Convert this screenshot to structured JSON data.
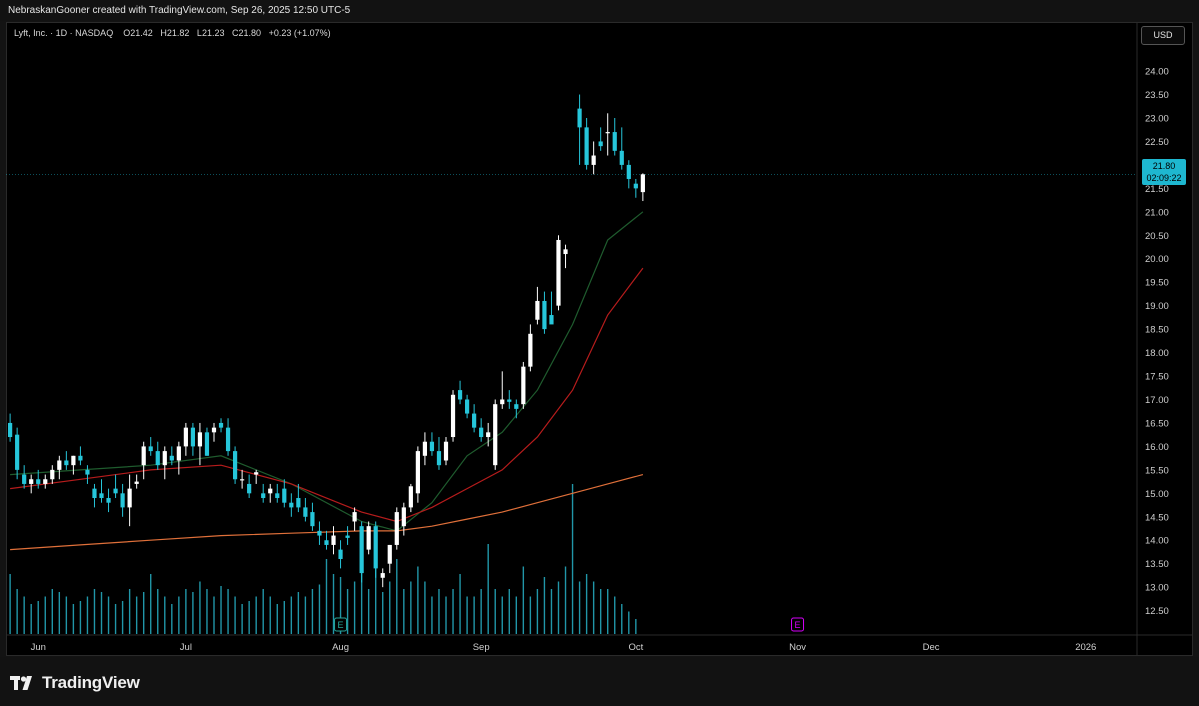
{
  "header": {
    "attribution": "NebraskanGooner created with TradingView.com, Sep 26, 2025 12:50 UTC-5"
  },
  "legend": {
    "symbol_info": "Lyft, Inc. · 1D · NASDAQ",
    "o_label": "O",
    "o_value": "21.42",
    "h_label": "H",
    "h_value": "21.82",
    "l_label": "L",
    "l_value": "21.23",
    "c_label": "C",
    "c_value": "21.80",
    "change": "+0.23 (+1.07%)"
  },
  "currency_button": "USD",
  "last_price": {
    "value": "21.80",
    "countdown": "02:09:22"
  },
  "footer": {
    "brand": "TradingView"
  },
  "colors": {
    "up_candle": "#ffffff",
    "down_candle": "#26c6da",
    "ema_fast": "#1f5c2e",
    "ema_mid": "#b71c1c",
    "ema_slow": "#e0703a",
    "volume": "#2196a8",
    "last_price_tag": "#1eb7d0",
    "earnings_marker_past": "#26a69a",
    "earnings_marker_future": "#d500f9"
  },
  "chart_data": {
    "type": "candlestick",
    "y_axis": {
      "range": [
        12.3,
        24.3
      ],
      "ticks": [
        "24.00",
        "23.50",
        "23.00",
        "22.50",
        "22.00",
        "21.50",
        "21.00",
        "20.50",
        "20.00",
        "19.50",
        "19.00",
        "18.50",
        "18.00",
        "17.50",
        "17.00",
        "16.50",
        "16.00",
        "15.50",
        "15.00",
        "14.50",
        "14.00",
        "13.50",
        "13.00",
        "12.50"
      ]
    },
    "x_axis": {
      "ticks": [
        {
          "label": "Jun",
          "index": 4
        },
        {
          "label": "Jul",
          "index": 25
        },
        {
          "label": "Aug",
          "index": 47
        },
        {
          "label": "Sep",
          "index": 67
        },
        {
          "label": "Oct",
          "index": 89
        },
        {
          "label": "Nov",
          "index": 112
        },
        {
          "label": "Dec",
          "index": 131
        },
        {
          "label": "2026",
          "index": 153
        }
      ],
      "index_range": [
        -0.3,
        160
      ]
    },
    "candles": [
      [
        16.5,
        16.7,
        16.1,
        16.2
      ],
      [
        16.25,
        16.4,
        15.3,
        15.5
      ],
      [
        15.4,
        15.6,
        15.1,
        15.2
      ],
      [
        15.2,
        15.4,
        15.0,
        15.3
      ],
      [
        15.3,
        15.5,
        15.1,
        15.2
      ],
      [
        15.2,
        15.4,
        15.1,
        15.3
      ],
      [
        15.3,
        15.6,
        15.2,
        15.5
      ],
      [
        15.5,
        15.8,
        15.3,
        15.7
      ],
      [
        15.7,
        15.9,
        15.5,
        15.6
      ],
      [
        15.6,
        15.8,
        15.4,
        15.8
      ],
      [
        15.8,
        16.0,
        15.6,
        15.7
      ],
      [
        15.5,
        15.6,
        15.2,
        15.4
      ],
      [
        15.1,
        15.2,
        14.7,
        14.9
      ],
      [
        15.0,
        15.3,
        14.8,
        14.9
      ],
      [
        14.9,
        15.1,
        14.6,
        14.8
      ],
      [
        15.1,
        15.4,
        14.9,
        15.0
      ],
      [
        15.0,
        15.2,
        14.5,
        14.7
      ],
      [
        14.7,
        15.4,
        14.3,
        15.1
      ],
      [
        15.2,
        15.4,
        15.1,
        15.25
      ],
      [
        15.6,
        16.1,
        15.3,
        16.0
      ],
      [
        16.0,
        16.2,
        15.8,
        15.9
      ],
      [
        15.9,
        16.1,
        15.5,
        15.6
      ],
      [
        15.6,
        16.0,
        15.3,
        15.9
      ],
      [
        15.8,
        16.0,
        15.6,
        15.7
      ],
      [
        15.7,
        16.1,
        15.4,
        16.0
      ],
      [
        16.0,
        16.5,
        15.8,
        16.4
      ],
      [
        16.4,
        16.5,
        15.8,
        16.0
      ],
      [
        16.0,
        16.5,
        15.6,
        16.3
      ],
      [
        16.3,
        16.4,
        15.8,
        15.8
      ],
      [
        16.3,
        16.5,
        16.1,
        16.4
      ],
      [
        16.5,
        16.6,
        16.3,
        16.4
      ],
      [
        16.4,
        16.6,
        15.8,
        15.9
      ],
      [
        15.9,
        16.0,
        15.2,
        15.3
      ],
      [
        15.3,
        15.5,
        15.1,
        15.3
      ],
      [
        15.2,
        15.4,
        14.9,
        15.0
      ],
      [
        15.4,
        15.5,
        15.2,
        15.45
      ],
      [
        15.0,
        15.2,
        14.8,
        14.9
      ],
      [
        15.0,
        15.2,
        14.8,
        15.1
      ],
      [
        15.0,
        15.2,
        14.8,
        14.9
      ],
      [
        15.1,
        15.3,
        14.7,
        14.8
      ],
      [
        14.8,
        15.0,
        14.5,
        14.7
      ],
      [
        14.9,
        15.2,
        14.6,
        14.7
      ],
      [
        14.7,
        14.9,
        14.4,
        14.5
      ],
      [
        14.6,
        14.8,
        14.2,
        14.3
      ],
      [
        14.2,
        14.4,
        13.9,
        14.1
      ],
      [
        14.0,
        14.2,
        13.8,
        13.9
      ],
      [
        13.9,
        14.3,
        13.7,
        14.1
      ],
      [
        13.8,
        14.0,
        13.4,
        13.6
      ],
      [
        14.1,
        14.3,
        13.9,
        14.05
      ],
      [
        14.4,
        14.7,
        14.2,
        14.6
      ],
      [
        14.3,
        14.4,
        13.1,
        13.3
      ],
      [
        13.8,
        14.4,
        13.7,
        14.3
      ],
      [
        14.3,
        14.4,
        13.2,
        13.4
      ],
      [
        13.2,
        13.4,
        13.0,
        13.3
      ],
      [
        13.5,
        13.9,
        13.3,
        13.9
      ],
      [
        13.9,
        14.7,
        13.8,
        14.6
      ],
      [
        14.3,
        14.8,
        14.1,
        14.7
      ],
      [
        14.7,
        15.2,
        14.6,
        15.15
      ],
      [
        15.0,
        16.0,
        14.8,
        15.9
      ],
      [
        15.8,
        16.3,
        15.6,
        16.1
      ],
      [
        16.1,
        16.3,
        15.8,
        15.9
      ],
      [
        15.9,
        16.2,
        15.5,
        15.6
      ],
      [
        15.7,
        16.2,
        15.6,
        16.1
      ],
      [
        16.2,
        17.2,
        16.1,
        17.1
      ],
      [
        17.2,
        17.4,
        16.9,
        17.0
      ],
      [
        17.0,
        17.1,
        16.6,
        16.7
      ],
      [
        16.7,
        16.9,
        16.3,
        16.4
      ],
      [
        16.4,
        16.6,
        16.1,
        16.2
      ],
      [
        16.2,
        16.5,
        16.0,
        16.3
      ],
      [
        15.6,
        17.0,
        15.5,
        16.9
      ],
      [
        16.9,
        17.6,
        16.8,
        17.0
      ],
      [
        17.0,
        17.2,
        16.8,
        16.95
      ],
      [
        16.9,
        17.0,
        16.6,
        16.8
      ],
      [
        16.9,
        17.8,
        16.8,
        17.7
      ],
      [
        17.7,
        18.6,
        17.6,
        18.4
      ],
      [
        18.7,
        19.4,
        18.6,
        19.1
      ],
      [
        19.1,
        19.3,
        18.4,
        18.5
      ],
      [
        18.8,
        19.3,
        18.7,
        18.6
      ],
      [
        19.0,
        20.5,
        18.9,
        20.4
      ],
      [
        20.1,
        20.3,
        19.8,
        20.2
      ],
      [
        23.2,
        23.5,
        22.0,
        22.8
      ],
      [
        22.8,
        23.0,
        21.9,
        22.0
      ],
      [
        22.0,
        22.5,
        21.8,
        22.2
      ],
      [
        22.5,
        22.8,
        22.3,
        22.4
      ],
      [
        22.7,
        23.1,
        22.2,
        22.7
      ],
      [
        22.7,
        23.0,
        22.2,
        22.3
      ],
      [
        22.3,
        22.8,
        21.9,
        22.0
      ],
      [
        22.0,
        22.1,
        21.5,
        21.7
      ],
      [
        21.6,
        21.7,
        21.3,
        21.5
      ],
      [
        21.42,
        21.82,
        21.23,
        21.8
      ]
    ],
    "candle_indices": [
      0,
      1,
      2,
      3,
      4,
      5,
      6,
      7,
      8,
      9,
      10,
      11,
      12,
      13,
      14,
      15,
      16,
      17,
      18,
      19,
      20,
      21,
      22,
      23,
      24,
      25,
      26,
      27,
      28,
      29,
      30,
      31,
      32,
      33,
      34,
      35,
      36,
      37,
      38,
      39,
      40,
      41,
      42,
      43,
      44,
      45,
      46,
      47,
      48,
      49,
      50,
      51,
      52,
      53,
      54,
      55,
      56,
      57,
      58,
      59,
      60,
      61,
      62,
      63,
      64,
      65,
      66,
      67,
      68,
      69,
      70,
      71,
      72,
      73,
      74,
      75,
      76,
      77,
      78,
      79,
      81,
      82,
      83,
      84,
      85,
      86,
      87,
      88,
      89,
      90
    ],
    "moving_averages": [
      {
        "color_key": "ema_fast",
        "values": [
          [
            0,
            15.4
          ],
          [
            10,
            15.5
          ],
          [
            20,
            15.6
          ],
          [
            30,
            15.8
          ],
          [
            40,
            15.2
          ],
          [
            50,
            14.4
          ],
          [
            55,
            14.2
          ],
          [
            60,
            14.8
          ],
          [
            65,
            15.8
          ],
          [
            70,
            16.3
          ],
          [
            75,
            17.2
          ],
          [
            80,
            18.6
          ],
          [
            85,
            20.4
          ],
          [
            90,
            21.0
          ]
        ]
      },
      {
        "color_key": "ema_mid",
        "values": [
          [
            0,
            15.1
          ],
          [
            10,
            15.3
          ],
          [
            20,
            15.5
          ],
          [
            30,
            15.6
          ],
          [
            40,
            15.2
          ],
          [
            50,
            14.6
          ],
          [
            55,
            14.4
          ],
          [
            60,
            14.7
          ],
          [
            65,
            15.1
          ],
          [
            70,
            15.5
          ],
          [
            75,
            16.2
          ],
          [
            80,
            17.2
          ],
          [
            85,
            18.8
          ],
          [
            90,
            19.8
          ]
        ]
      },
      {
        "color_key": "ema_slow",
        "values": [
          [
            0,
            13.8
          ],
          [
            10,
            13.9
          ],
          [
            20,
            14.0
          ],
          [
            30,
            14.1
          ],
          [
            40,
            14.15
          ],
          [
            50,
            14.2
          ],
          [
            55,
            14.2
          ],
          [
            60,
            14.3
          ],
          [
            65,
            14.45
          ],
          [
            70,
            14.6
          ],
          [
            75,
            14.8
          ],
          [
            80,
            15.0
          ],
          [
            85,
            15.2
          ],
          [
            90,
            15.4
          ]
        ]
      }
    ],
    "volume": {
      "relative": [
        0.4,
        0.3,
        0.25,
        0.2,
        0.22,
        0.25,
        0.3,
        0.28,
        0.25,
        0.2,
        0.22,
        0.25,
        0.3,
        0.28,
        0.25,
        0.2,
        0.22,
        0.3,
        0.25,
        0.28,
        0.4,
        0.3,
        0.25,
        0.2,
        0.25,
        0.3,
        0.28,
        0.35,
        0.3,
        0.25,
        0.32,
        0.3,
        0.25,
        0.2,
        0.22,
        0.25,
        0.3,
        0.25,
        0.2,
        0.22,
        0.25,
        0.28,
        0.25,
        0.3,
        0.33,
        0.5,
        0.4,
        0.38,
        0.3,
        0.35,
        0.45,
        0.3,
        0.45,
        0.28,
        0.35,
        0.5,
        0.3,
        0.35,
        0.45,
        0.35,
        0.25,
        0.3,
        0.25,
        0.3,
        0.4,
        0.25,
        0.25,
        0.3,
        0.6,
        0.3,
        0.25,
        0.3,
        0.25,
        0.45,
        0.25,
        0.3,
        0.38,
        0.3,
        0.35,
        0.45,
        1.0,
        0.35,
        0.4,
        0.35,
        0.3,
        0.3,
        0.25,
        0.2,
        0.15,
        0.1
      ]
    },
    "earnings_markers": [
      {
        "label": "E",
        "index": 47,
        "status": "past"
      },
      {
        "label": "E",
        "index": 112,
        "status": "future"
      }
    ]
  }
}
